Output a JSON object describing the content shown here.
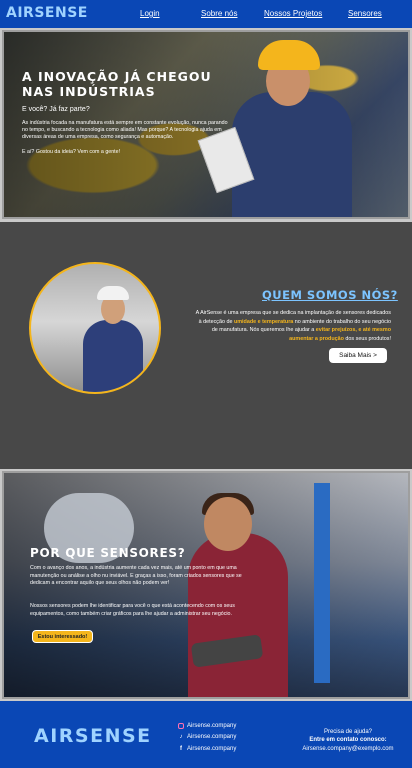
{
  "nav": {
    "logo": "AIRSENSE",
    "links": [
      "Login",
      "Sobre nós",
      "Nossos Projetos",
      "Sensores"
    ]
  },
  "hero": {
    "title": "A INOVAÇÃO JÁ CHEGOU NAS INDÚSTRIAS",
    "question": "E você? Já faz parte?",
    "paragraph": "As indústria focada na manufatura está sempre em constante evolução, nunca parando no tempo, e buscando a tecnologia como aliada! Mas porque? A tecnologia ajuda em diversas áreas de uma empresa, como segurança e automação.",
    "cta_text": "E aí? Gostou da ideia? Vem com a gente!"
  },
  "about": {
    "title": "QUEM SOMOS NÓS?",
    "text_1": "A AirSense é uma empresa que se dedica na implantação de sensores dedicados à detecção de ",
    "highlight_1": "umidade e temperatura",
    "text_2": " no ambiente do trabalho do seu negócio de manufatura. Nós queremos lhe ajudar a ",
    "highlight_2": "evitar prejuízos, e até mesmo aumentar a produção",
    "text_3": " dos seus produtos!",
    "button": "Saiba Mais >"
  },
  "sensors": {
    "title": "POR QUE SENSORES?",
    "paragraph_1": "Com o avanço dos anos, a indústria aumente cada vez mais, até um ponto em que uma manutenção ou análise a olho nu inviável. E graças a isso, foram criados sensores que se dedicam a encontrar aquilo que seus olhos não podem ver!",
    "paragraph_2": "Nossos sensores podem lhe identificar para você o que está acontecendo com os seus equipamentos, como também criar gráficos para lhe ajudar a administrar seu negócio.",
    "button": "Estou interessado!"
  },
  "footer": {
    "logo": "AIRSENSE",
    "social": [
      {
        "icon": "instagram-icon",
        "label": "Airsense.company"
      },
      {
        "icon": "tiktok-icon",
        "label": "Airsense.company"
      },
      {
        "icon": "facebook-icon",
        "label": "Airsense.company"
      }
    ],
    "help": "Precisa de ajuda?",
    "contact_label": "Entre em contato conosco:",
    "email": "Airsense.company@exemplo.com"
  },
  "colors": {
    "brand_blue": "#0a47b5",
    "logo_light_blue": "#9fd3ff",
    "accent_yellow": "#f4b51c",
    "about_bg": "#484848"
  }
}
